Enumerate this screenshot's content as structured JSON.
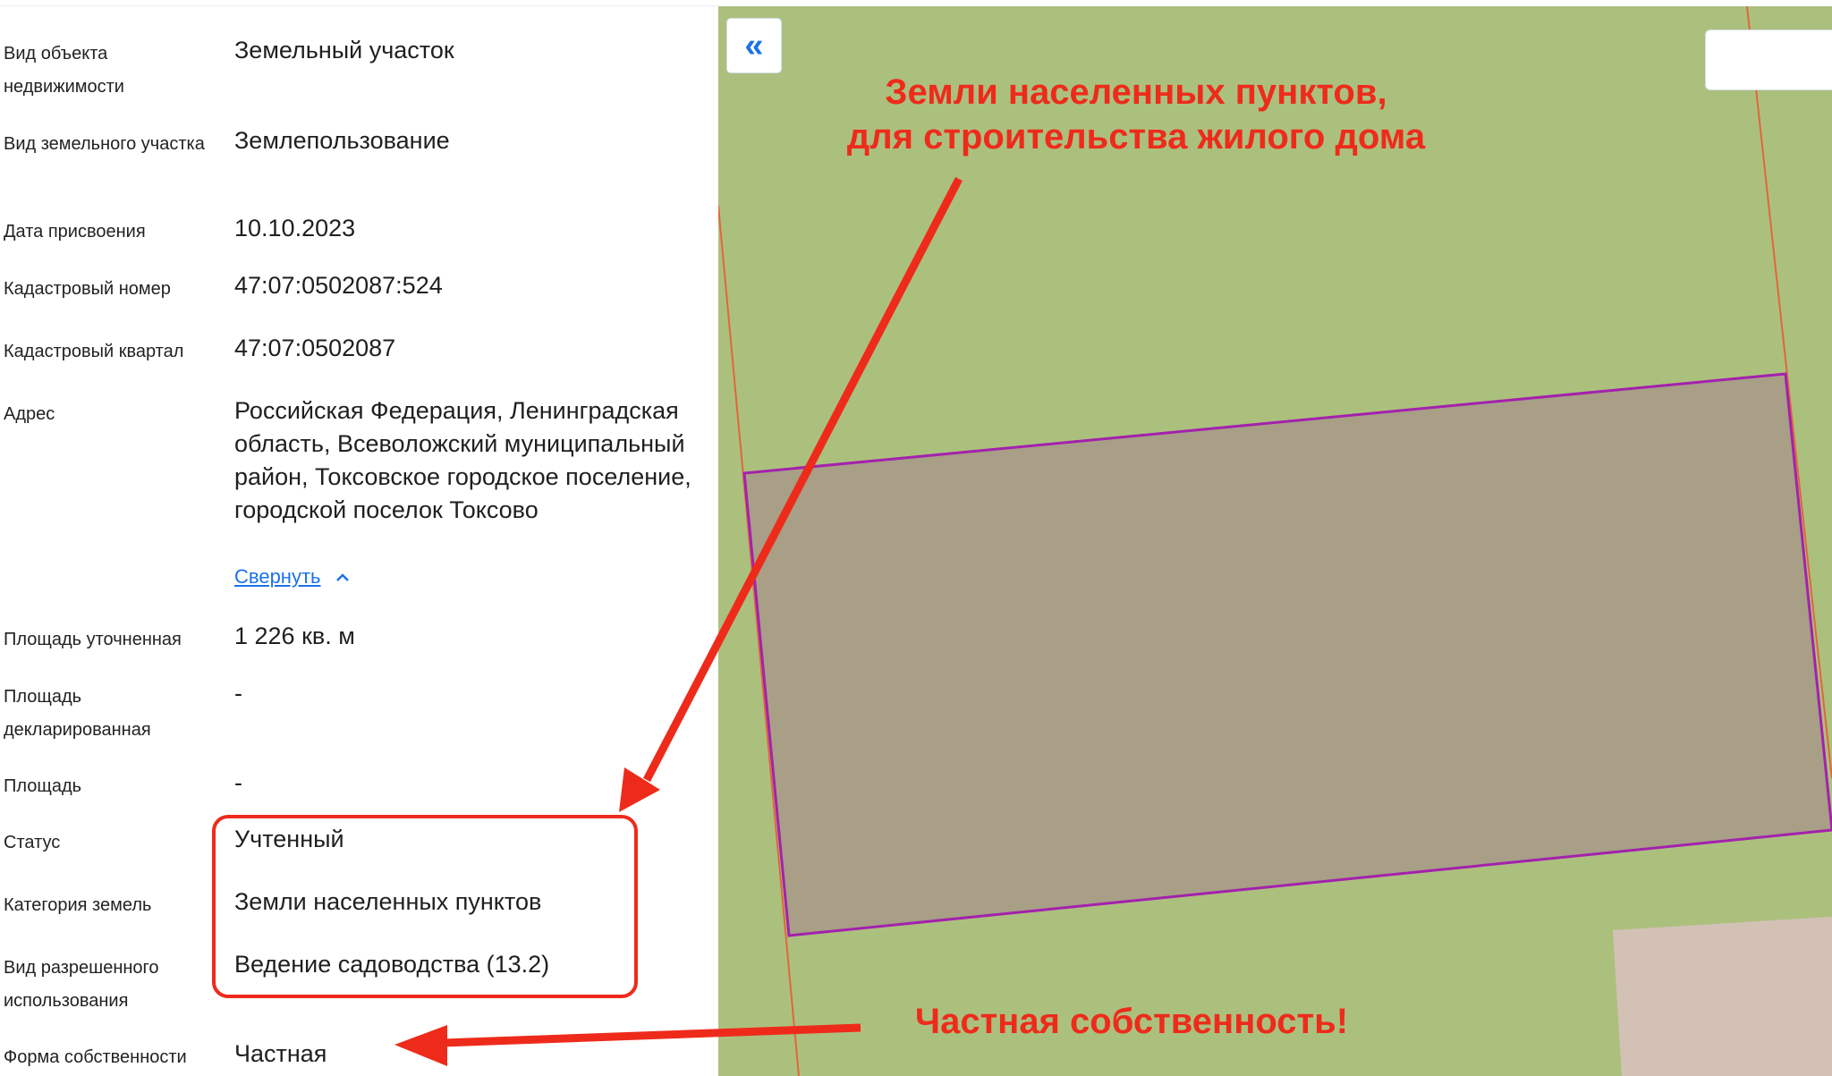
{
  "details": {
    "rows": [
      {
        "label": "Вид объекта недвижимости",
        "value": "Земельный участок"
      },
      {
        "label": "Вид земельного участка",
        "value": "Землепользование"
      },
      {
        "label": "Дата присвоения",
        "value": "10.10.2023"
      },
      {
        "label": "Кадастровый номер",
        "value": "47:07:0502087:524"
      },
      {
        "label": "Кадастровый квартал",
        "value": "47:07:0502087"
      },
      {
        "label": "Адрес",
        "value": "Российская Федерация, Ленинградская область, Всеволожский муниципальный район, Токсовское городское поселение, городской поселок Токсово"
      },
      {
        "label": "Площадь уточненная",
        "value": "1 226 кв. м"
      },
      {
        "label": "Площадь декларированная",
        "value": "-"
      },
      {
        "label": "Площадь",
        "value": "-"
      },
      {
        "label": "Статус",
        "value": "Учтенный"
      },
      {
        "label": "Категория земель",
        "value": "Земли населенных пунктов"
      },
      {
        "label": "Вид разрешенного использования",
        "value": "Ведение садоводства (13.2)"
      },
      {
        "label": "Форма собственности",
        "value": "Частная"
      }
    ],
    "collapse_link": "Свернуть"
  },
  "map": {
    "collapse_button": "«",
    "colors": {
      "background": "#acc07e",
      "parcel_fill": "#a89f86",
      "parcel_border": "#a321ad",
      "boundary_line": "#e0663c",
      "neighbor_fill": "#d4c1b6"
    }
  },
  "annotations": {
    "top_line1": "Земли населенных пунктов,",
    "top_line2": "для строительства жилого дома",
    "bottom": "Частная собственность!",
    "color": "#ee2b1b"
  }
}
